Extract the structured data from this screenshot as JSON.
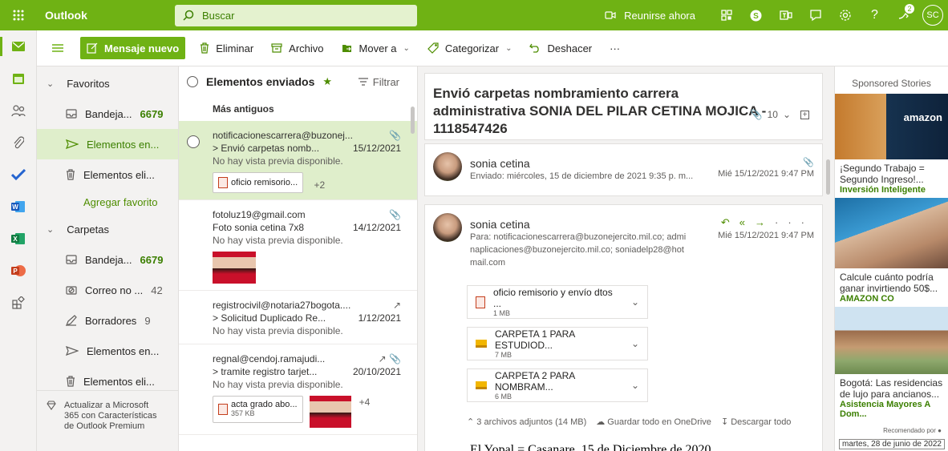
{
  "topbar": {
    "app_name": "Outlook",
    "search_placeholder": "Buscar",
    "meet_now": "Reunirse ahora",
    "notification_count": "2",
    "avatar_initials": "SC"
  },
  "commands": {
    "new_message": "Mensaje nuevo",
    "delete": "Eliminar",
    "archive": "Archivo",
    "move_to": "Mover a",
    "categorize": "Categorizar",
    "undo": "Deshacer",
    "more": "···"
  },
  "folders": {
    "favorites_label": "Favoritos",
    "favorites": [
      {
        "label": "Bandeja...",
        "count": "6679"
      },
      {
        "label": "Elementos en...",
        "count": ""
      },
      {
        "label": "Elementos eli...",
        "count": ""
      }
    ],
    "add_favorite": "Agregar favorito",
    "folders_label": "Carpetas",
    "items": [
      {
        "label": "Bandeja...",
        "count": "6679"
      },
      {
        "label": "Correo no ...",
        "count": "42"
      },
      {
        "label": "Borradores",
        "count": "9"
      },
      {
        "label": "Elementos en...",
        "count": ""
      },
      {
        "label": "Elementos eli...",
        "count": ""
      }
    ],
    "upgrade_text": "Actualizar a Microsoft 365 con Características de Outlook Premium"
  },
  "mail_list": {
    "title": "Elementos enviados",
    "filter": "Filtrar",
    "group": "Más antiguos",
    "messages": [
      {
        "from": "notificacionescarrera@buzonej...",
        "subject": "> Envió carpetas nomb...",
        "date": "15/12/2021",
        "preview": "No hay vista previa disponible.",
        "attachment": "oficio remisorio...",
        "extra": "+2"
      },
      {
        "from": "fotoluz19@gmail.com",
        "subject": "Foto sonia cetina 7x8",
        "date": "14/12/2021",
        "preview": "No hay vista previa disponible."
      },
      {
        "from": "registrocivil@notaria27bogota....",
        "subject": "> Solicitud Duplicado Re...",
        "date": "1/12/2021",
        "preview": "No hay vista previa disponible."
      },
      {
        "from": "regnal@cendoj.ramajudi...",
        "subject": "> tramite registro tarjet...",
        "date": "20/10/2021",
        "preview": "No hay vista previa disponible.",
        "attachment": "acta grado abo...",
        "attachment_size": "357 KB",
        "extra": "+4"
      }
    ]
  },
  "reading": {
    "subject": "Envió carpetas nombramiento carrera administrativa SONIA DEL PILAR CETINA MOJICA - 1118547426",
    "attachment_count": "10",
    "first": {
      "sender": "sonia cetina",
      "sent": "Enviado: miércoles, 15 de diciembre de 2021 9:35 p. m...",
      "date": "Mié 15/12/2021 9:47 PM"
    },
    "second": {
      "sender": "sonia cetina",
      "to_line1": "Para: notificacionescarrera@buzonejercito.mil.co; admi",
      "to_line2": "naplicaciones@buzonejercito.mil.co; soniadelp28@hot",
      "to_line3": "mail.com",
      "date": "Mié 15/12/2021 9:47 PM"
    },
    "attachments": [
      {
        "name": "oficio remisorio y envío dtos ...",
        "size": "1 MB"
      },
      {
        "name": "CARPETA 1 PARA ESTUDIOD...",
        "size": "7 MB"
      },
      {
        "name": "CARPETA 2 PARA NOMBRAM...",
        "size": "6 MB"
      }
    ],
    "attach_summary": "3 archivos adjuntos (14 MB)",
    "save_onedrive": "Guardar todo en OneDrive",
    "download_all": "Descargar todo",
    "body_start": "El Yopal = Casanare, 15 de Diciembre de 2020"
  },
  "ads": {
    "header": "Sponsored Stories",
    "items": [
      {
        "text": "¡Segundo Trabajo = Segundo Ingreso!...",
        "source": "Inversión Inteligente"
      },
      {
        "text": "Calcule cuánto podría ganar invirtiendo 50$...",
        "source": "AMAZON CO"
      },
      {
        "text": "Bogotá: Las residencias de lujo para ancianos...",
        "source": "Asistencia Mayores A Dom..."
      }
    ],
    "recommended": "Recomendado por",
    "date": "martes, 28 de junio de 2022",
    "amazon_word": "amazon"
  }
}
